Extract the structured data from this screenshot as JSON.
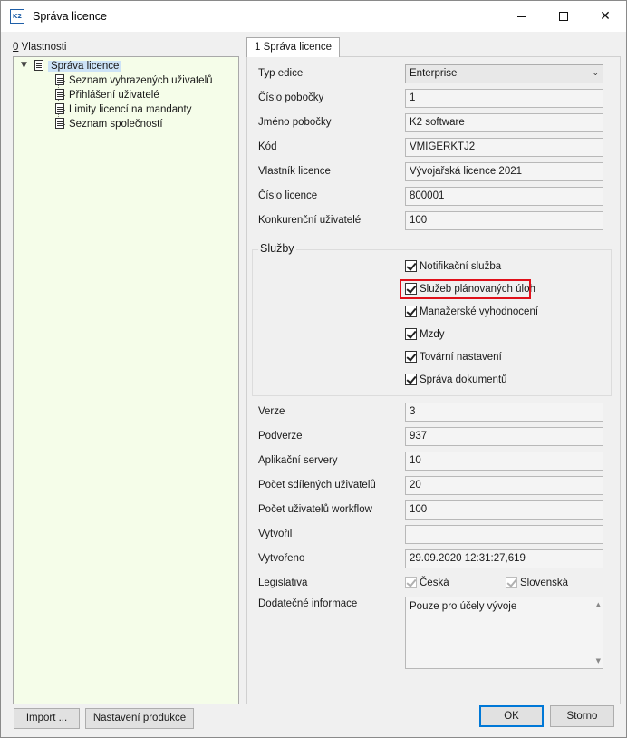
{
  "window": {
    "title": "Správa licence",
    "app_icon": "K2"
  },
  "left": {
    "label_prefix": "0",
    "label_rest": " Vlastnosti",
    "tree": {
      "root": "Správa licence",
      "children": [
        "Seznam vyhrazených uživatelů",
        "Přihlášení uživatelé",
        "Limity licencí na mandanty",
        "Seznam společností"
      ]
    },
    "buttons": {
      "import": "Import ...",
      "settings": "Nastavení produkce"
    }
  },
  "tab": {
    "label": "1 Správa licence"
  },
  "fields": {
    "edition": {
      "label": "Typ edice",
      "value": "Enterprise"
    },
    "branch_no": {
      "label": "Číslo pobočky",
      "value": "1"
    },
    "branch_name": {
      "label": "Jméno pobočky",
      "value": "K2 software"
    },
    "code": {
      "label": "Kód",
      "value": "VMIGERKTJ2"
    },
    "owner": {
      "label": "Vlastník licence",
      "value": "Vývojařská licence 2021"
    },
    "license_no": {
      "label": "Číslo licence",
      "value": "800001"
    },
    "concurrent": {
      "label": "Konkurenční uživatelé",
      "value": "100"
    }
  },
  "services": {
    "title": "Služby",
    "items": [
      {
        "label": "Notifikační služba",
        "checked": true
      },
      {
        "label": "Služeb plánovaných úloh",
        "checked": true
      },
      {
        "label": "Manažerské vyhodnocení",
        "checked": true
      },
      {
        "label": "Mzdy",
        "checked": true
      },
      {
        "label": "Tovární nastavení",
        "checked": true
      },
      {
        "label": "Správa dokumentů",
        "checked": true
      }
    ],
    "highlight_color": "#e0101a"
  },
  "info": {
    "version": {
      "label": "Verze",
      "value": "3"
    },
    "subversion": {
      "label": "Podverze",
      "value": "937"
    },
    "app_servers": {
      "label": "Aplikační servery",
      "value": "10"
    },
    "shared_users": {
      "label": "Počet sdílených uživatelů",
      "value": "20"
    },
    "workflow_users": {
      "label": "Počet uživatelů workflow",
      "value": "100"
    },
    "created_by": {
      "label": "Vytvořil",
      "value": ""
    },
    "created_at": {
      "label": "Vytvořeno",
      "value": "29.09.2020 12:31:27,619"
    },
    "legislation": {
      "label": "Legislativa",
      "options": [
        {
          "label": "Česká",
          "checked": true
        },
        {
          "label": "Slovenská",
          "checked": true
        }
      ]
    },
    "additional": {
      "label": "Dodatečné informace",
      "value": "Pouze pro účely vývoje"
    }
  },
  "dialog_buttons": {
    "ok": "OK",
    "cancel": "Storno"
  },
  "colors": {
    "tree_bg": "#f5fde9",
    "selection": "#cde3f7",
    "default_button_border": "#0078d7"
  }
}
